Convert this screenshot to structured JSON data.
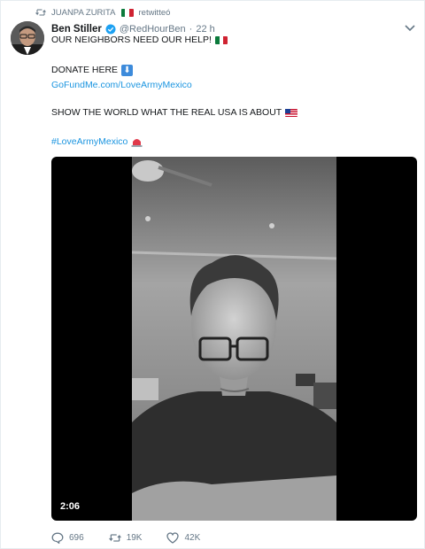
{
  "retweet": {
    "user": "JUANPA ZURITA",
    "suffix": "retwitteó"
  },
  "tweet": {
    "author_name": "Ben Stiller",
    "author_handle": "@RedHourBen",
    "separator": "·",
    "time": "22 h",
    "line1": "OUR NEIGHBORS NEED OUR HELP!",
    "line2": "DONATE HERE",
    "link": "GoFundMe.com/LoveArmyMexico",
    "line3": "SHOW THE WORLD WHAT THE REAL USA IS ABOUT",
    "hashtag": "#LoveArmyMexico"
  },
  "video": {
    "duration": "2:06"
  },
  "actions": {
    "replies": "696",
    "retweets": "19K",
    "likes": "42K"
  },
  "icons": {
    "retweet": "retweet-icon",
    "verified": "verified-badge-icon",
    "menu": "chevron-down-icon",
    "reply": "reply-icon",
    "like": "heart-icon",
    "donate": "down-arrow-emoji-icon",
    "usa": "us-flag-emoji-icon",
    "mexico": "mexico-flag-emoji-icon",
    "siren": "siren-emoji-icon"
  },
  "colors": {
    "link": "#1b95e0",
    "muted": "#657786",
    "verified": "#1da1f2"
  }
}
